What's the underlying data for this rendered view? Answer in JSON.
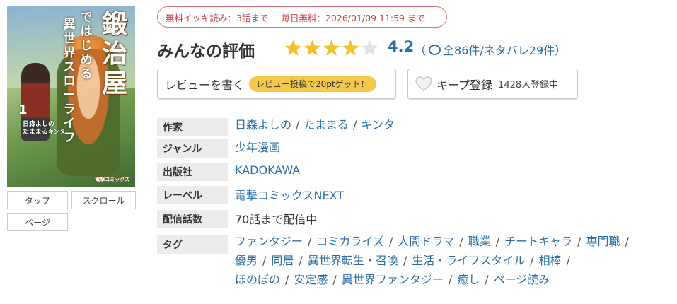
{
  "cover": {
    "title": "鍛治屋",
    "subtitle_a": "ではじめる",
    "subtitle_b": "異世界",
    "subtitle_c": "スローライフ",
    "volume": "1",
    "author_line": "日森よしの",
    "author_line2": "たままる",
    "author_line3": "キンタ",
    "publisher": "電撃コミックス"
  },
  "view_modes": [
    "タップ",
    "スクロール",
    "ページ"
  ],
  "free_badge": {
    "part1": "無料イッキ読み：3話まで",
    "part2": "毎日無料：2026/01/09 11:59 まで"
  },
  "rating": {
    "title": "みんなの評価",
    "stars_filled": 4,
    "stars_total": 5,
    "score": "4.2",
    "open_paren": "（",
    "counts": "全86件/ネタバレ29件",
    "close_paren": "）"
  },
  "actions": {
    "review_label": "レビューを書く",
    "review_promo": "レビュー投稿で20ptゲット！",
    "keep_label": "キープ登録",
    "keep_count": "1428人登録中"
  },
  "info": {
    "author_label": "作家",
    "authors": [
      "日森よしの",
      "たままる",
      "キンタ"
    ],
    "genre_label": "ジャンル",
    "genre": "少年漫画",
    "publisher_label": "出版社",
    "publisher": "KADOKAWA",
    "label_label": "レーベル",
    "label": "電撃コミックスNEXT",
    "episodes_label": "配信話数",
    "episodes": "70話まで配信中",
    "tags_label": "タグ",
    "tags_line1": [
      "ファンタジー",
      "コミカライズ",
      "人間ドラマ",
      "職業",
      "チートキャラ",
      "専門職"
    ],
    "tags_line2": [
      "優男",
      "同居",
      "異世界転生・召喚",
      "生活・ライフスタイル",
      "相棒"
    ],
    "tags_line3": [
      "ほのぼの",
      "安定感",
      "異世界ファンタジー",
      "癒し",
      "ページ読み"
    ]
  },
  "colors": {
    "link": "#2a6fa8",
    "star": "#f2c230",
    "badge_red": "#c94444",
    "promo_yellow": "#f4c94a"
  }
}
